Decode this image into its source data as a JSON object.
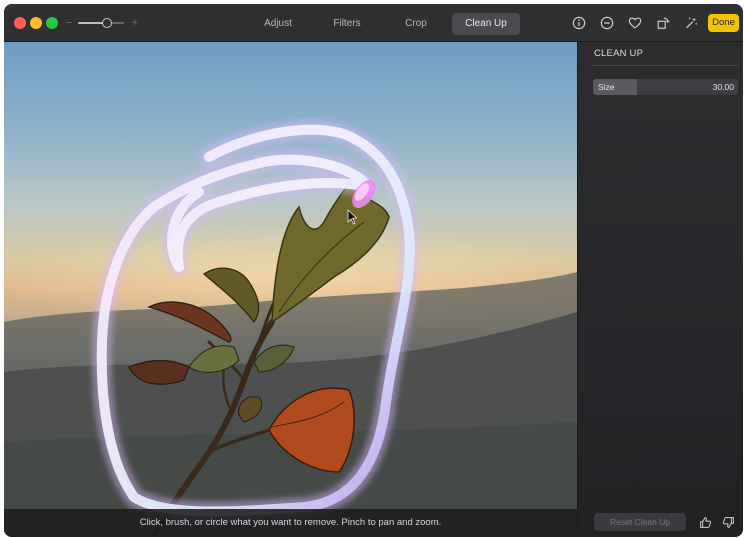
{
  "toolbar": {
    "tabs": [
      {
        "label": "Adjust",
        "active": false
      },
      {
        "label": "Filters",
        "active": false
      },
      {
        "label": "Crop",
        "active": false
      },
      {
        "label": "Clean Up",
        "active": true
      }
    ],
    "zoom": {
      "minus_symbol": "−",
      "plus_symbol": "+",
      "level": 0.62
    },
    "icons": [
      "info-icon",
      "minus-circle-icon",
      "heart-icon",
      "rotate-icon",
      "magic-wand-icon"
    ],
    "done_label": "Done",
    "accent_color": "#f5c400"
  },
  "photo": {
    "hint": "Click, brush, or circle what you want to remove. Pinch to pan and zoom."
  },
  "sidebar": {
    "title": "CLEAN UP",
    "size_slider": {
      "label": "Size",
      "value": "30.00",
      "fraction": 0.3
    },
    "reset_label": "Reset Clean Up",
    "feedback_icons": [
      "thumbs-up-icon",
      "thumbs-down-icon"
    ]
  }
}
